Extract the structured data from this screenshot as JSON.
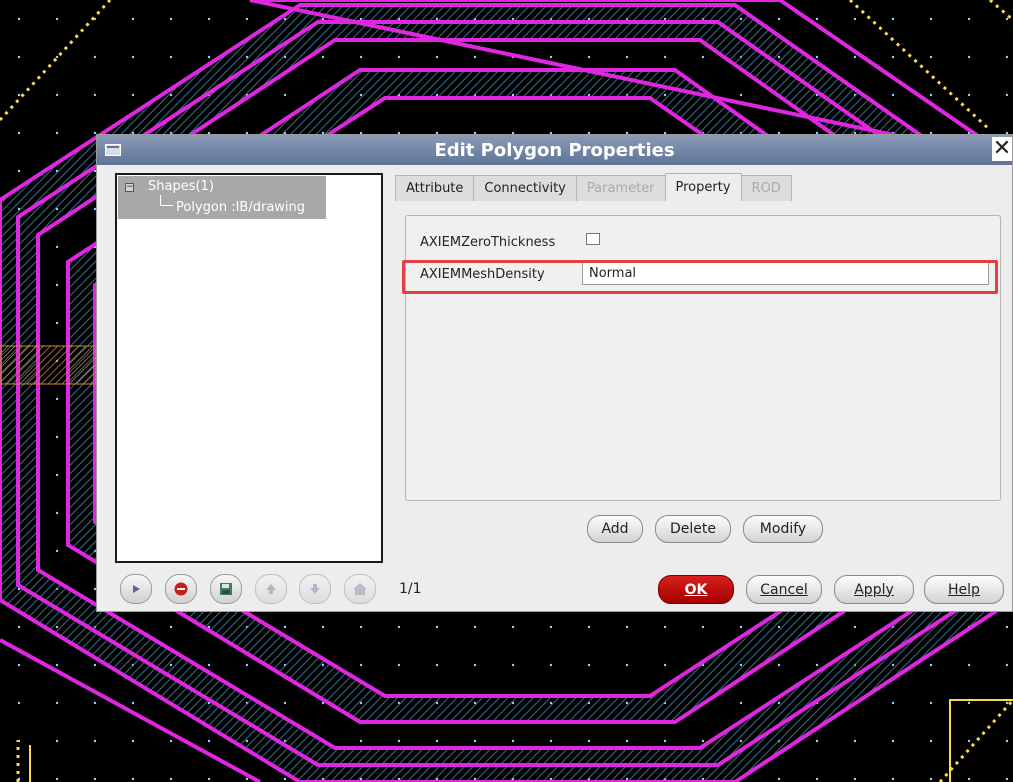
{
  "colors": {
    "canvas_bg": "#000000",
    "trace_magenta": "#e026e0",
    "hatch_blue": "#3c7d9a",
    "guide_yellow": "#ffd84a",
    "ok_button": "#c41010",
    "highlight_box": "#e34045"
  },
  "dialog": {
    "title": "Edit Polygon Properties",
    "close_glyph": "✕",
    "tree": {
      "root_label": "Shapes(1)",
      "child_label": "Polygon :IB/drawing"
    },
    "tabs": [
      {
        "label": "Attribute",
        "state": "normal"
      },
      {
        "label": "Connectivity",
        "state": "normal"
      },
      {
        "label": "Parameter",
        "state": "disabled"
      },
      {
        "label": "Property",
        "state": "active"
      },
      {
        "label": "ROD",
        "state": "disabled"
      }
    ],
    "properties": {
      "zero_thickness_label": "AXIEMZeroThickness",
      "zero_thickness_checked": false,
      "mesh_density_label": "AXIEMMeshDensity",
      "mesh_density_value": "Normal"
    },
    "property_buttons": {
      "add": "Add",
      "delete": "Delete",
      "modify": "Modify"
    },
    "toolbar_icons": [
      "play-icon",
      "stop-icon",
      "save-icon",
      "up-arrow-icon",
      "down-arrow-icon",
      "home-icon"
    ],
    "page_info": "1/1",
    "footer_buttons": {
      "ok": "OK",
      "cancel": "Cancel",
      "apply": "Apply",
      "help": "Help"
    }
  }
}
